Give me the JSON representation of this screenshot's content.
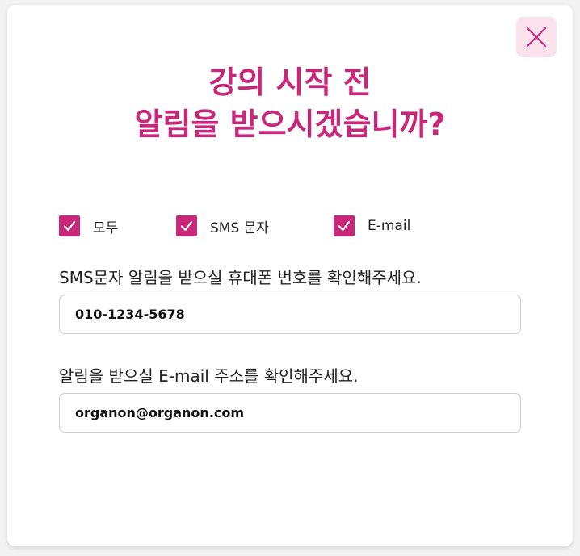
{
  "modal": {
    "title_line1": "강의 시작 전",
    "title_line2": "알림을 받으시겠습니까?",
    "close_icon": "close-icon",
    "accent_color": "#c9287a",
    "close_bg_color": "#fbe3ee"
  },
  "options": {
    "all": {
      "label": "모두",
      "checked": true
    },
    "sms": {
      "label": "SMS 문자",
      "checked": true
    },
    "email": {
      "label": "E-mail",
      "checked": true
    }
  },
  "sms_field": {
    "label": "SMS문자 알림을 받으실 휴대폰 번호를 확인해주세요.",
    "value": "010-1234-5678"
  },
  "email_field": {
    "label": "알림을 받으실 E-mail 주소를 확인해주세요.",
    "value": "organon@organon.com"
  }
}
